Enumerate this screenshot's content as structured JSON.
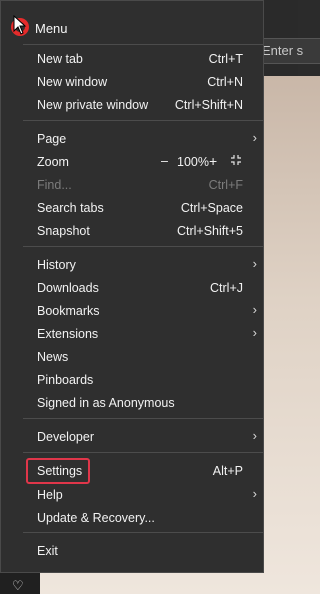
{
  "background": {
    "address_hint": "Enter s",
    "heart_icon": "heart-icon"
  },
  "menu": {
    "title": "Menu",
    "items": [
      {
        "label": "New tab",
        "shortcut": "Ctrl+T"
      },
      {
        "label": "New window",
        "shortcut": "Ctrl+N"
      },
      {
        "label": "New private window",
        "shortcut": "Ctrl+Shift+N"
      },
      {
        "label": "Page",
        "shortcut": ""
      },
      {
        "label": "Zoom",
        "shortcut": ""
      },
      {
        "label": "Find...",
        "shortcut": "Ctrl+F"
      },
      {
        "label": "Search tabs",
        "shortcut": "Ctrl+Space"
      },
      {
        "label": "Snapshot",
        "shortcut": "Ctrl+Shift+5"
      },
      {
        "label": "History",
        "shortcut": ""
      },
      {
        "label": "Downloads",
        "shortcut": "Ctrl+J"
      },
      {
        "label": "Bookmarks",
        "shortcut": ""
      },
      {
        "label": "Extensions",
        "shortcut": ""
      },
      {
        "label": "News",
        "shortcut": ""
      },
      {
        "label": "Pinboards",
        "shortcut": ""
      },
      {
        "label": "Signed in as Anonymous",
        "shortcut": ""
      },
      {
        "label": "Developer",
        "shortcut": ""
      },
      {
        "label": "Settings",
        "shortcut": "Alt+P"
      },
      {
        "label": "Help",
        "shortcut": ""
      },
      {
        "label": "Update & Recovery...",
        "shortcut": ""
      },
      {
        "label": "Exit",
        "shortcut": ""
      }
    ],
    "zoom": {
      "minus": "–",
      "value": "100%",
      "plus": "+"
    }
  },
  "colors": {
    "menu_bg": "#2f2f2f",
    "highlight": "#e0364a",
    "logo": "#e52b2b"
  }
}
